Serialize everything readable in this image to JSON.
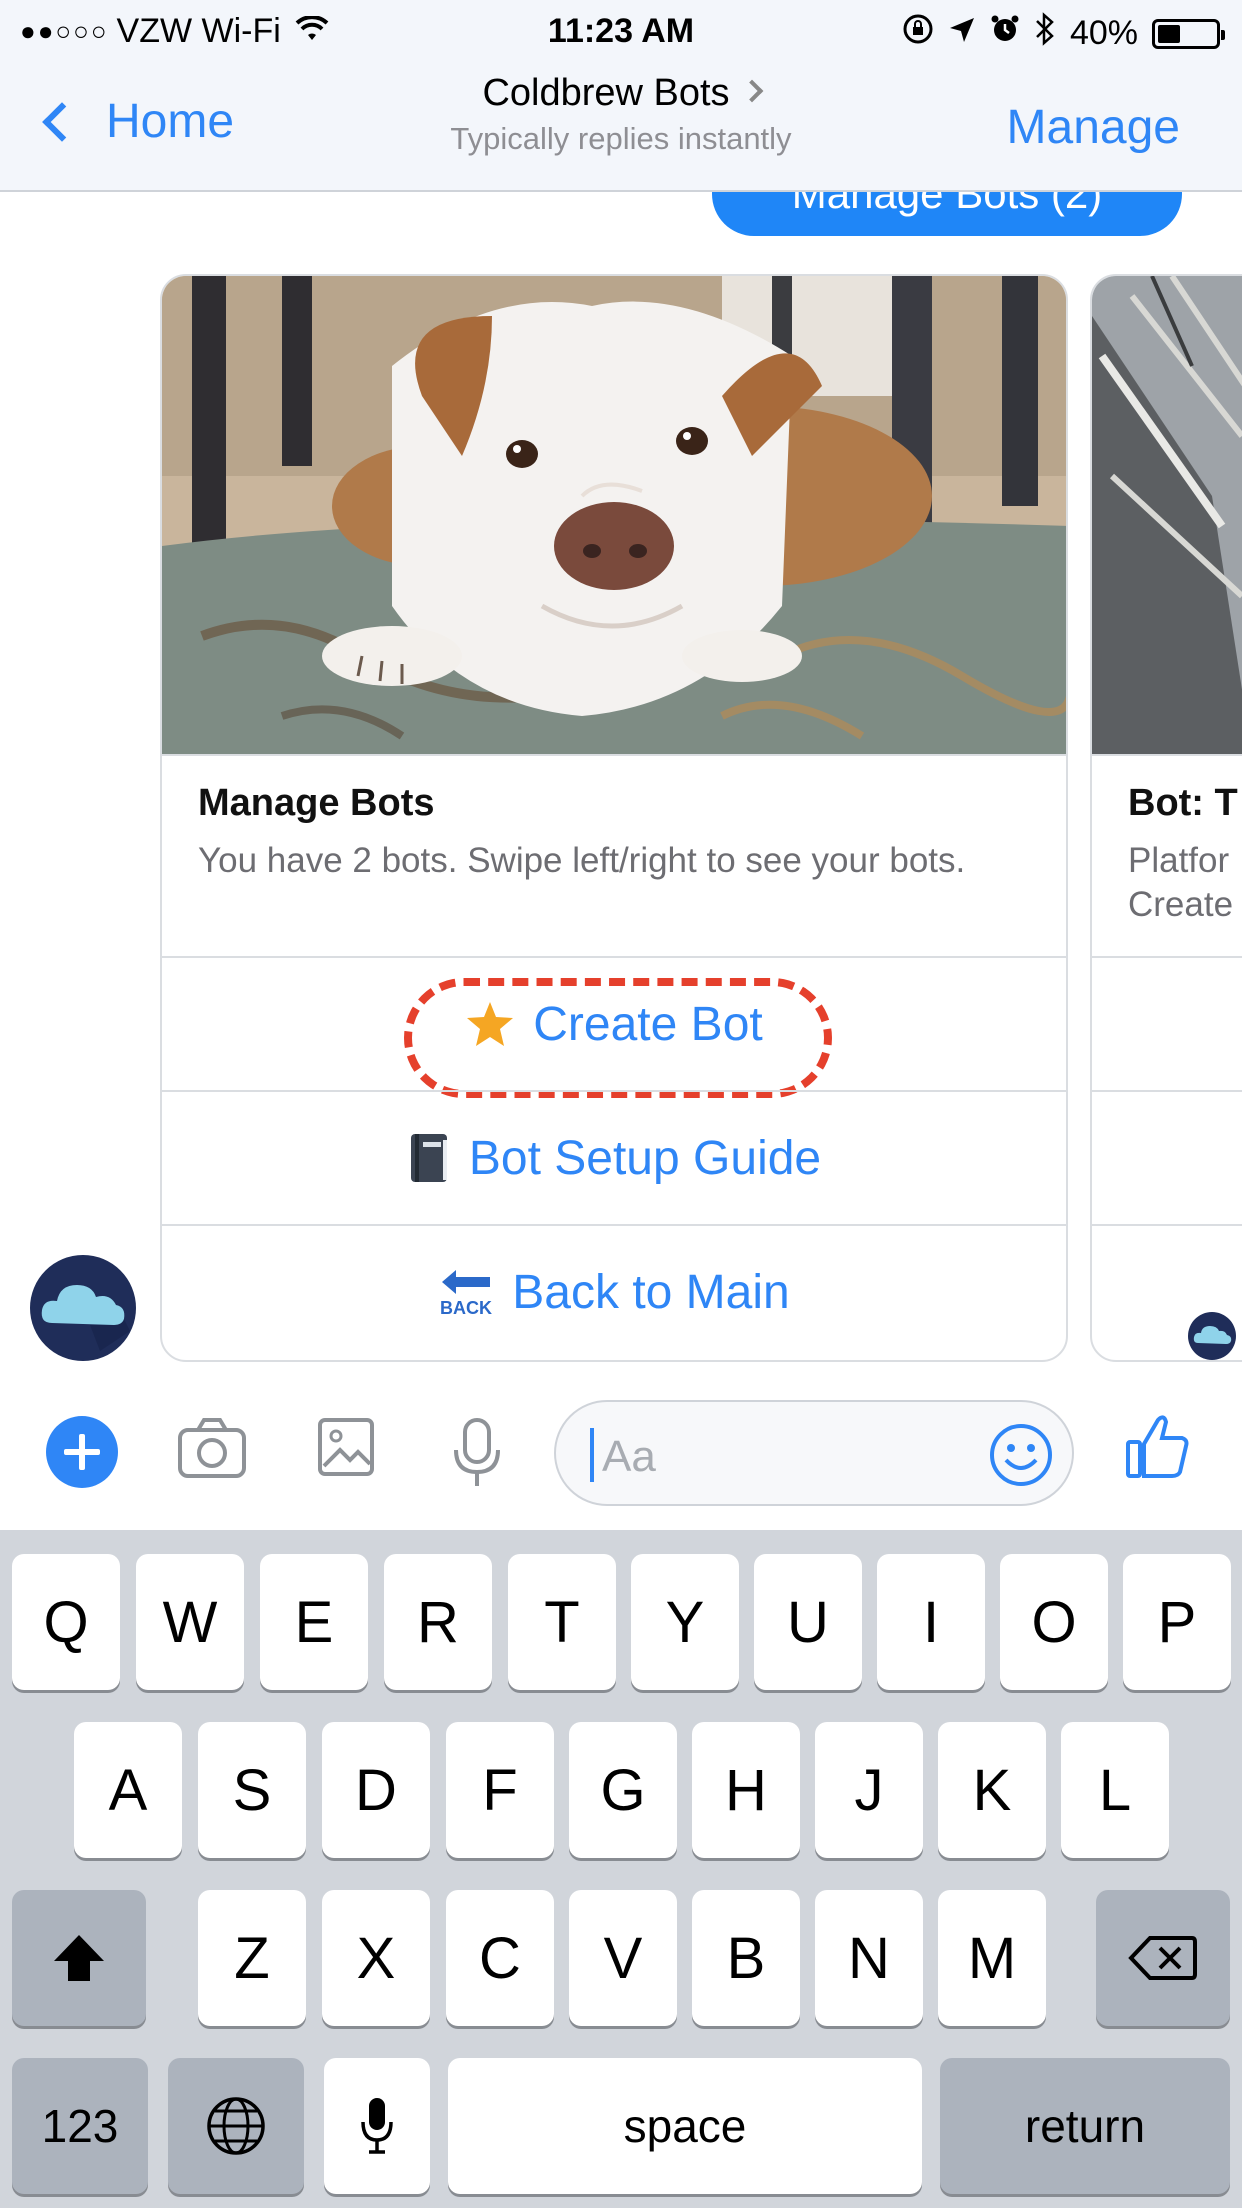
{
  "status_bar": {
    "carrier": "VZW Wi-Fi",
    "time": "11:23 AM",
    "battery": "40%",
    "battery_level": 0.4
  },
  "nav": {
    "back_label": "Home",
    "title": "Coldbrew Bots",
    "subtitle": "Typically replies instantly",
    "manage_label": "Manage"
  },
  "chat": {
    "previous_bubble": "Manage Bots (2)",
    "card": {
      "title": "Manage Bots",
      "subtitle": "You have 2 bots. Swipe left/right to see your bots.",
      "buttons": [
        {
          "label": "Create Bot",
          "icon": "star-icon"
        },
        {
          "label": "Bot Setup Guide",
          "icon": "notebook-icon"
        },
        {
          "label": "Back to Main",
          "icon": "back-arrow-icon",
          "icon_text": "BACK"
        }
      ]
    },
    "next_card": {
      "title": "Bot: T",
      "subtitle_line1": "Platfor",
      "subtitle_line2": "Create"
    }
  },
  "composer": {
    "placeholder": "Aa"
  },
  "keyboard": {
    "row1": [
      "Q",
      "W",
      "E",
      "R",
      "T",
      "Y",
      "U",
      "I",
      "O",
      "P"
    ],
    "row2": [
      "A",
      "S",
      "D",
      "F",
      "G",
      "H",
      "J",
      "K",
      "L"
    ],
    "row3": [
      "Z",
      "X",
      "C",
      "V",
      "B",
      "N",
      "M"
    ],
    "numbers_label": "123",
    "space_label": "space",
    "return_label": "return"
  },
  "colors": {
    "accent": "#2f86f6",
    "highlight_dash": "#e5402c"
  }
}
